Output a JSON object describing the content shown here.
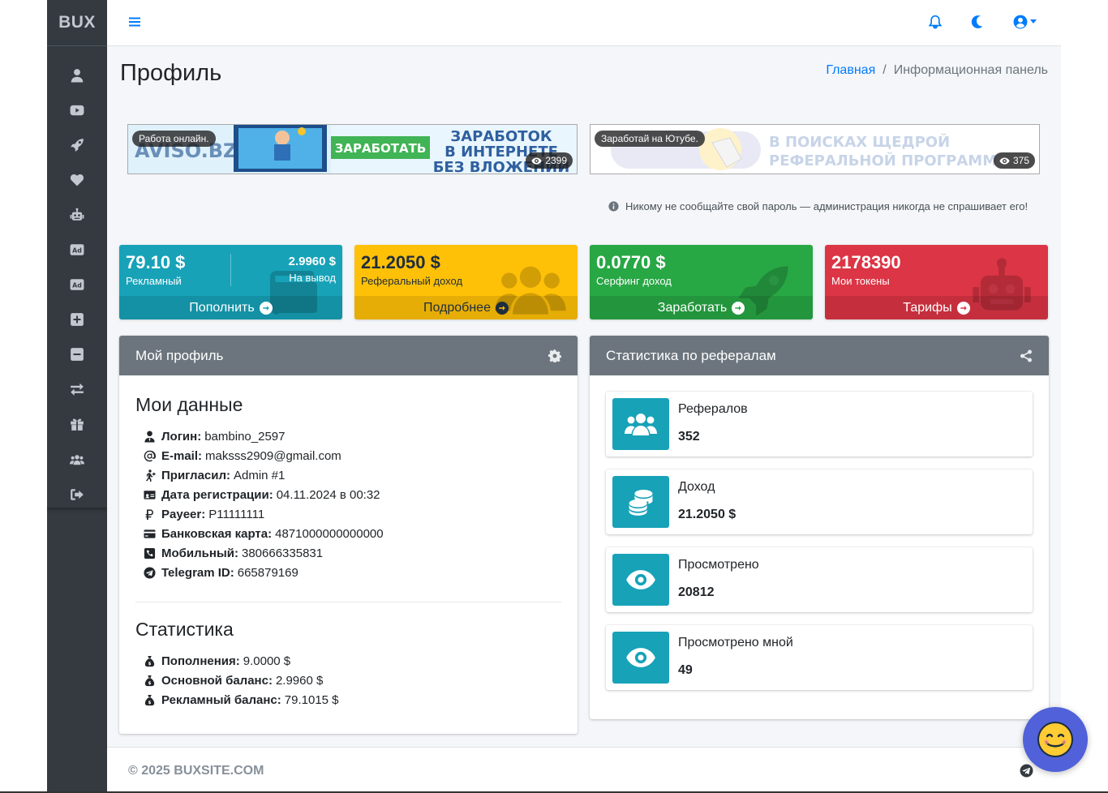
{
  "app": {
    "brand": "BUX"
  },
  "sidebar": {
    "items": [
      {
        "icon": "user-icon"
      },
      {
        "icon": "youtube-icon"
      },
      {
        "icon": "rocket-icon"
      },
      {
        "icon": "heart-icon"
      },
      {
        "icon": "robot-icon"
      },
      {
        "icon": "ad-icon"
      },
      {
        "icon": "ad-icon"
      },
      {
        "icon": "plus-square-icon"
      },
      {
        "icon": "minus-square-icon"
      },
      {
        "icon": "exchange-icon"
      },
      {
        "icon": "gift-icon"
      },
      {
        "icon": "users-icon"
      },
      {
        "icon": "sign-out-icon"
      }
    ]
  },
  "header": {
    "icons": [
      "menu-icon",
      "bell-icon",
      "moon-icon",
      "user-circle-icon"
    ]
  },
  "page": {
    "title": "Профиль",
    "breadcrumb": {
      "home": "Главная",
      "current": "Информационная панель"
    }
  },
  "banners": [
    {
      "tag": "Работа онлайн.",
      "views": "2399",
      "text_line1": "AVISO.BZ",
      "button": "ЗАРАБОТАТЬ",
      "text_line2": "ЗАРАБОТОК",
      "text_line3": "В ИНТЕРНЕТЕ",
      "text_line4": "БЕЗ ВЛОЖЕНИЙ"
    },
    {
      "tag": "Заработай на Ютубе.",
      "views": "375",
      "text_line1": "В ПОИСКАХ ЩЕДРОЙ",
      "text_line2": "РЕФЕРАЛЬНОЙ ПРОГРАММ"
    }
  ],
  "notice": "Никому не сообщайте свой пароль — администрация никогда не спрашивает его!",
  "stat_boxes": [
    {
      "value": "79.10 $",
      "label": "Рекламный",
      "value2": "2.9960 $",
      "label2": "На вывод",
      "action": "Пополнить",
      "color": "#17a2b8",
      "icon": "wallet-icon"
    },
    {
      "value": "21.2050 $",
      "label": "Реферальный доход",
      "action": "Подробнее",
      "color": "#ffc107",
      "icon": "users-icon"
    },
    {
      "value": "0.0770 $",
      "label": "Серфинг доход",
      "action": "Заработать",
      "color": "#28a745",
      "icon": "rocket-icon"
    },
    {
      "value": "2178390",
      "label": "Мои токены",
      "action": "Тарифы",
      "color": "#dc3545",
      "icon": "robot-icon"
    }
  ],
  "profile_card": {
    "title": "Мой профиль",
    "my_data_title": "Мои данные",
    "fields": [
      {
        "label": "Логин:",
        "value": "bambino_2597",
        "icon": "user-tie-icon"
      },
      {
        "label": "E-mail:",
        "value": "maksss2909@gmail.com",
        "icon": "at-icon"
      },
      {
        "label": "Пригласил:",
        "value": "Admin #1",
        "icon": "walking-icon"
      },
      {
        "label": "Дата регистрации:",
        "value": "04.11.2024 в 00:32",
        "icon": "id-card-icon"
      },
      {
        "label": "Payeer:",
        "value": "P11111111",
        "icon": "ruble-icon"
      },
      {
        "label": "Банковская карта:",
        "value": "4871000000000000",
        "icon": "credit-card-icon"
      },
      {
        "label": "Мобильный:",
        "value": "380666335831",
        "icon": "phone-icon"
      },
      {
        "label": "Telegram ID:",
        "value": "665879169",
        "icon": "telegram-icon"
      }
    ],
    "stats_title": "Статистика",
    "stats": [
      {
        "label": "Пополнения:",
        "value": "9.0000 $",
        "icon": "money-bag-icon"
      },
      {
        "label": "Основной баланс:",
        "value": "2.9960 $",
        "icon": "money-bag-icon"
      },
      {
        "label": "Рекламный баланс:",
        "value": "79.1015 $",
        "icon": "money-bag-icon"
      }
    ]
  },
  "referral_card": {
    "title": "Статистика по рефералам",
    "items": [
      {
        "label": "Рефералов",
        "value": "352",
        "icon": "users-icon"
      },
      {
        "label": "Доход",
        "value": "21.2050 $",
        "icon": "coins-icon"
      },
      {
        "label": "Просмотрено",
        "value": "20812",
        "icon": "eye-icon"
      },
      {
        "label": "Просмотрено мной",
        "value": "49",
        "icon": "eye-icon"
      }
    ]
  },
  "footer": {
    "copyright": "© 2025 BUXSITE.COM"
  }
}
